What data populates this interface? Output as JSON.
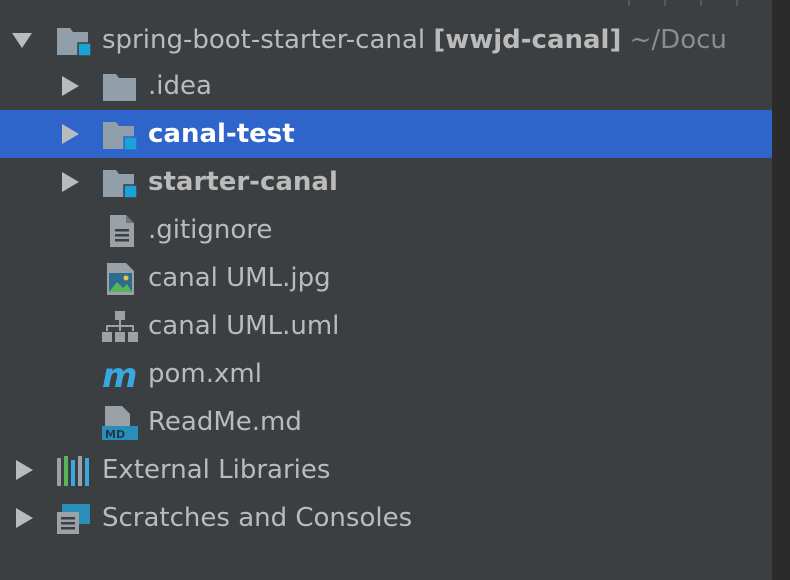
{
  "tree": {
    "root": {
      "name": "spring-boot-starter-canal",
      "module": "[wwjd-canal]",
      "path": "~/Docu",
      "expanded": true,
      "icon": "module-folder-icon"
    },
    "items": [
      {
        "label": ".idea",
        "icon": "folder-icon",
        "expandable": true,
        "selected": false
      },
      {
        "label": "canal-test",
        "icon": "module-folder-icon",
        "expandable": true,
        "selected": true
      },
      {
        "label": "starter-canal",
        "icon": "module-folder-icon",
        "expandable": true,
        "selected": false
      },
      {
        "label": ".gitignore",
        "icon": "text-file-icon",
        "expandable": false,
        "selected": false
      },
      {
        "label": "canal UML.jpg",
        "icon": "image-file-icon",
        "expandable": false,
        "selected": false
      },
      {
        "label": "canal UML.uml",
        "icon": "uml-diagram-icon",
        "expandable": false,
        "selected": false
      },
      {
        "label": "pom.xml",
        "icon": "maven-icon",
        "expandable": false,
        "selected": false
      },
      {
        "label": "ReadMe.md",
        "icon": "markdown-file-icon",
        "expandable": false,
        "selected": false
      }
    ],
    "bottom": [
      {
        "label": "External Libraries",
        "icon": "libraries-icon",
        "expandable": true
      },
      {
        "label": "Scratches and Consoles",
        "icon": "scratches-icon",
        "expandable": true
      }
    ]
  },
  "colors": {
    "background": "#3c3f41",
    "selection": "#2f65ca",
    "text": "#bbbbbb",
    "folder": "#909fa9",
    "module_badge": "#1aa3d9"
  }
}
